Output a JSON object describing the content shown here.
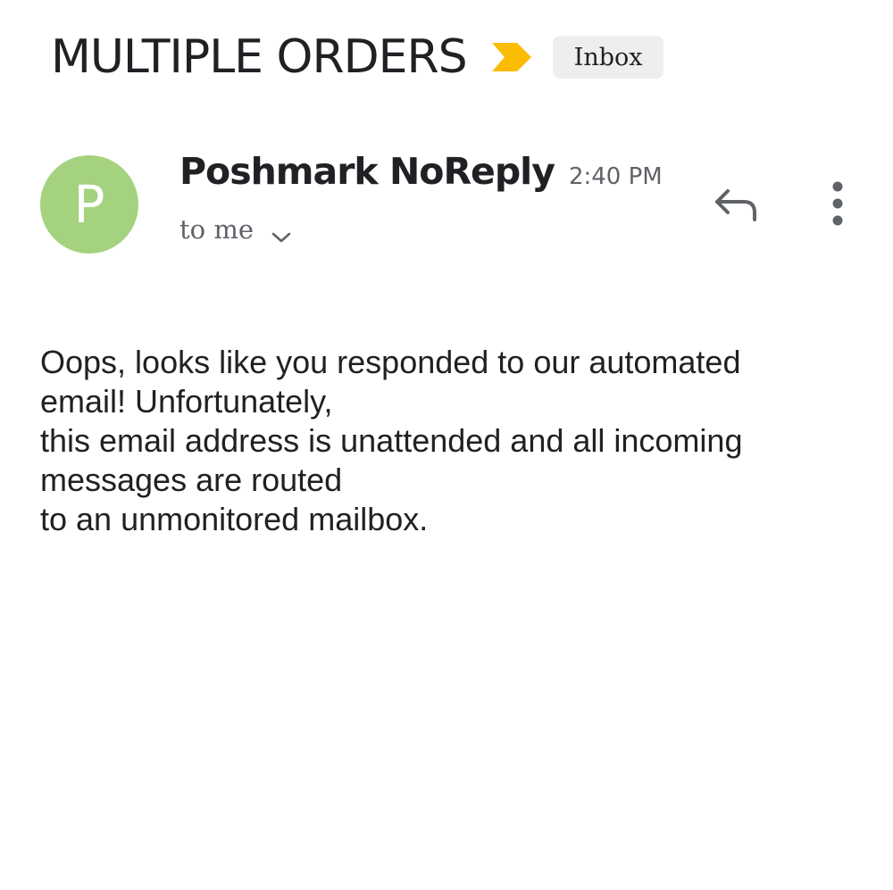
{
  "email": {
    "subject": "MULTIPLE ORDERS",
    "label": "Inbox",
    "sender": {
      "initial": "P",
      "name": "Poshmark NoReply",
      "time": "2:40 PM",
      "recipient": "to me",
      "avatar_color": "#a5d27f"
    },
    "body_lines": [
      "Oops, looks like you responded to our automated",
      "email! Unfortunately,",
      "this email address is unattended and all incoming",
      "messages are routed",
      "to an unmonitored mailbox."
    ]
  },
  "colors": {
    "importance_marker": "#fbbc04",
    "label_chip_bg": "#eeeeee",
    "secondary_text": "#5f6368",
    "icon": "#5f6368"
  },
  "icons": {
    "importance": "importance-marker-icon",
    "expand": "chevron-down-icon",
    "reply": "reply-icon",
    "more": "more-vert-icon"
  }
}
